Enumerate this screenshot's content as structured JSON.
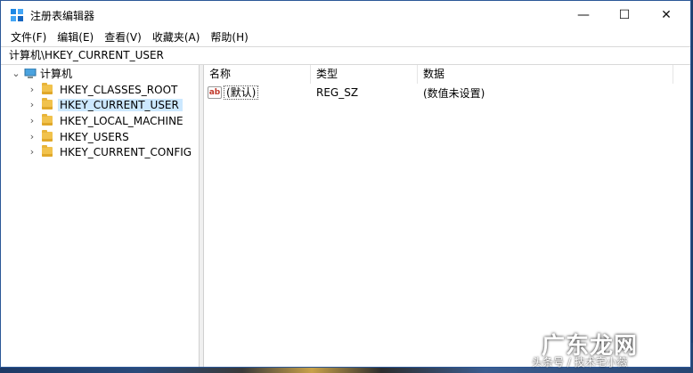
{
  "window": {
    "title": "注册表编辑器",
    "minimize_glyph": "—",
    "maximize_glyph": "☐",
    "close_glyph": "✕"
  },
  "menu": [
    "文件(F)",
    "编辑(E)",
    "查看(V)",
    "收藏夹(A)",
    "帮助(H)"
  ],
  "address": "计算机\\HKEY_CURRENT_USER",
  "tree": {
    "root": "计算机",
    "items": [
      {
        "label": "HKEY_CLASSES_ROOT",
        "selected": false
      },
      {
        "label": "HKEY_CURRENT_USER",
        "selected": true
      },
      {
        "label": "HKEY_LOCAL_MACHINE",
        "selected": false
      },
      {
        "label": "HKEY_USERS",
        "selected": false
      },
      {
        "label": "HKEY_CURRENT_CONFIG",
        "selected": false
      }
    ]
  },
  "list": {
    "columns": [
      "名称",
      "类型",
      "数据"
    ],
    "rows": [
      {
        "icon": "ab",
        "name": "(默认)",
        "type": "REG_SZ",
        "data": "(数值未设置)"
      }
    ]
  },
  "watermark": {
    "main": "广东龙网",
    "sub": "头条号 / 技术宅小薇"
  },
  "colors": {
    "selection": "#cce8ff",
    "folder": "#f1c24c",
    "window_border": "#2b5797"
  }
}
